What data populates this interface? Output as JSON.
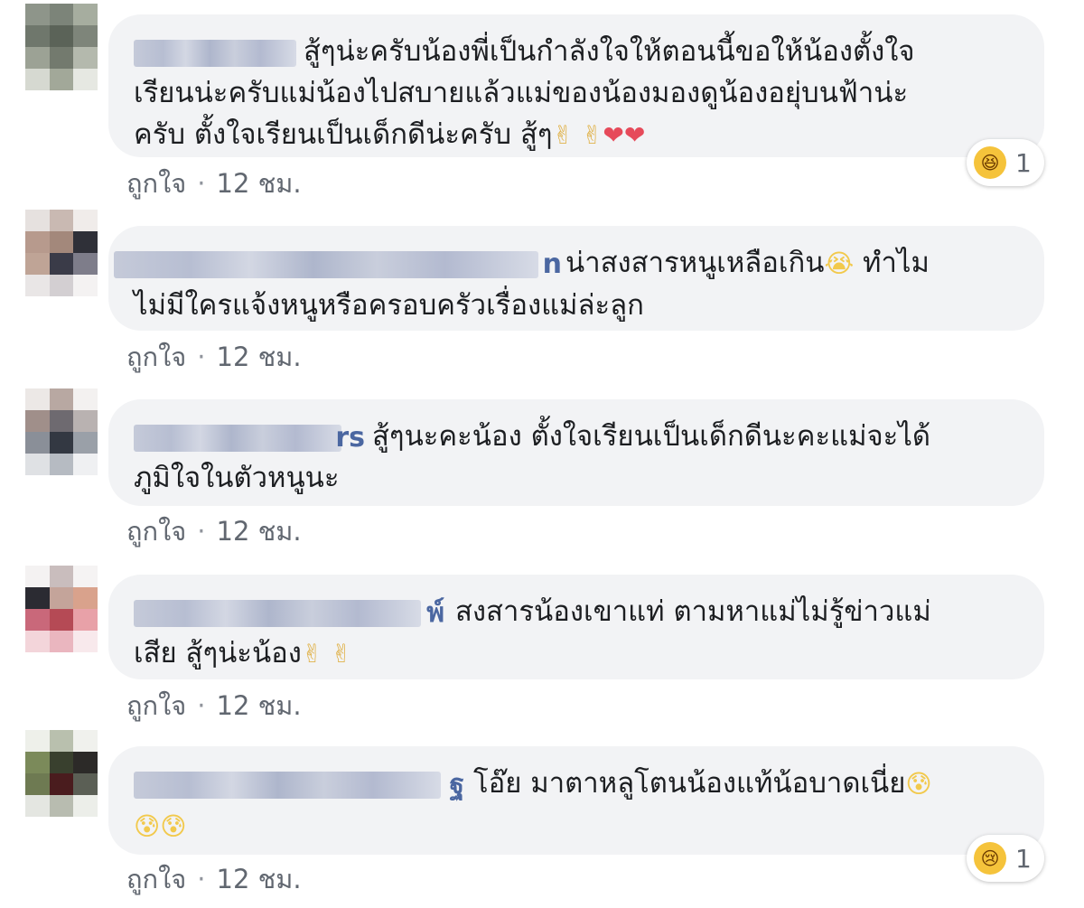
{
  "comments": [
    {
      "name_suffix": "",
      "text_line1": "สู้ๆน่ะครับน้องพี่เป็นกำลังใจให้ตอนนี้ขอให้น้องตั้งใจ",
      "text_line2": "เรียนน่ะครับแม่น้องไปสบายแล้วแม่ของน้องมองดูน้องอยุ่บนฟ้าน่ะ",
      "text_line3": "ครับ ตั้งใจเรียนเป็นเด็กดีน่ะครับ สู้ๆ",
      "emoji_peace": "✌ ✌",
      "emoji_hearts": "❤❤",
      "like_label": "ถูกใจ",
      "time": "12 ชม.",
      "reaction_icon": "laughing-face-icon",
      "reaction_count": "1"
    },
    {
      "name_suffix": "n",
      "text_line1": "น่าสงสารหนูเหลือเกิน",
      "emoji_cry": "😭",
      "text_line1b": " ทำไม",
      "text_line2": "ไม่มีใครแจ้งหนูหรือครอบครัวเรื่องแม่ล่ะลูก",
      "like_label": "ถูกใจ",
      "time": "12 ชม."
    },
    {
      "name_suffix": "rs",
      "text_line1": "สู้ๆนะคะน้อง ตั้งใจเรียนเป็นเด็กดีนะคะแม่จะได้",
      "text_line2": "ภูมิใจในตัวหนูนะ",
      "like_label": "ถูกใจ",
      "time": "12 ชม."
    },
    {
      "name_suffix": "พ์",
      "text_line1": "สงสารน้องเขาแท่ ตามหาแม่ไม่รู้ข่าวแม่",
      "text_line2": "เสีย สู้ๆน่ะน้อง",
      "emoji_peace": "✌ ✌",
      "like_label": "ถูกใจ",
      "time": "12 ชม."
    },
    {
      "name_suffix": "ฐ",
      "text_line1": "โอ๊ย มาตาหลูโตนน้องแท้น้อบาดเนี่ย",
      "emoji_sad": "😰",
      "emoji_sad_line2": "😰😰",
      "like_label": "ถูกใจ",
      "time": "12 ชม.",
      "reaction_icon": "crying-face-icon",
      "reaction_count": "1"
    }
  ],
  "colors": {
    "bubble": "#f2f3f5",
    "meta_text": "#616770",
    "name_link": "#4b67a1",
    "reaction_face": "#f5c33b"
  }
}
